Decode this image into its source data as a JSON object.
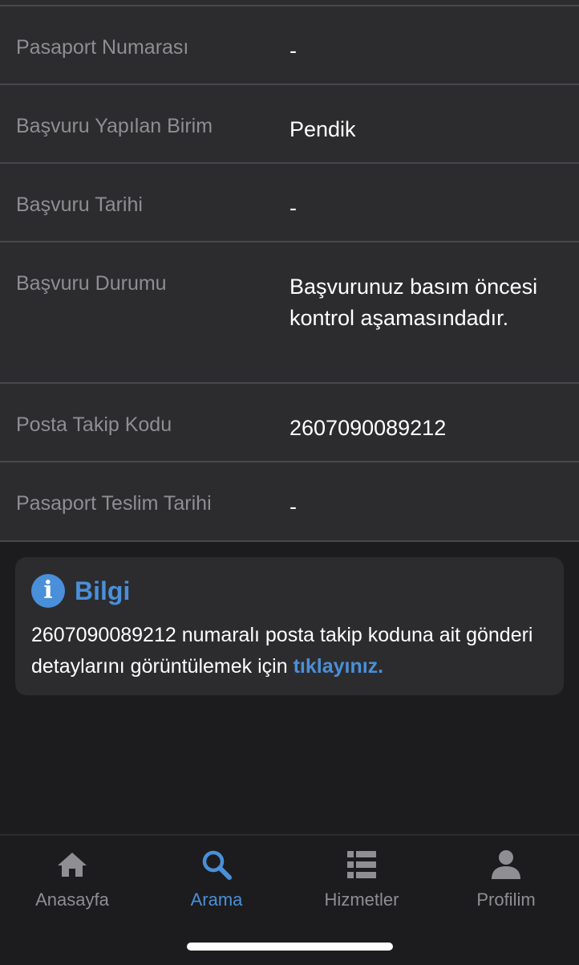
{
  "details": {
    "rows": [
      {
        "label": "Pasaport Numarası",
        "value": "-"
      },
      {
        "label": "Başvuru Yapılan Birim",
        "value": "Pendik"
      },
      {
        "label": "Başvuru Tarihi",
        "value": "-"
      },
      {
        "label": "Başvuru Durumu",
        "value": "Başvurunuz basım öncesi kontrol aşamasındadır."
      },
      {
        "label": "Posta Takip Kodu",
        "value": "2607090089212"
      },
      {
        "label": "Pasaport Teslim Tarihi",
        "value": "-"
      }
    ]
  },
  "info": {
    "icon": "info-icon",
    "icon_glyph": "i",
    "title": "Bilgi",
    "text": "2607090089212 numaralı posta takip koduna ait gönderi detaylarını görüntülemek için",
    "link_text": "tıklayınız."
  },
  "tabbar": {
    "tabs": [
      {
        "label": "Anasayfa",
        "icon": "home-icon",
        "active": false
      },
      {
        "label": "Arama",
        "icon": "search-icon",
        "active": true
      },
      {
        "label": "Hizmetler",
        "icon": "list-icon",
        "active": false
      },
      {
        "label": "Profilim",
        "icon": "person-icon",
        "active": false
      }
    ]
  },
  "colors": {
    "background": "#1c1c1e",
    "panel": "#2c2c2e",
    "divider": "#48484c",
    "accent": "#4a8fd9",
    "label": "#8e8e93",
    "text": "#ffffff"
  }
}
